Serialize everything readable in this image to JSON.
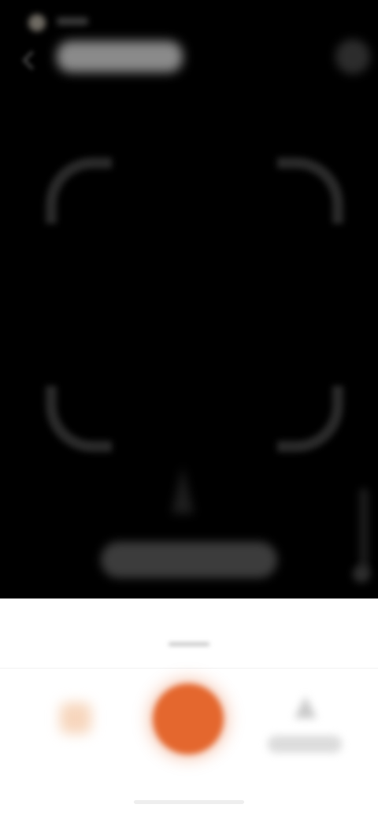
{
  "app": {
    "screen": "camera-scanner"
  },
  "header": {
    "title": "",
    "back_icon": "back-arrow-icon",
    "more_icon": "more-icon"
  },
  "viewfinder": {
    "hint": "",
    "flash_icon": "flashlight-icon"
  },
  "bottom": {
    "mode_label": "",
    "album_label": "",
    "history_label": "",
    "accent_color": "#e4672e"
  }
}
